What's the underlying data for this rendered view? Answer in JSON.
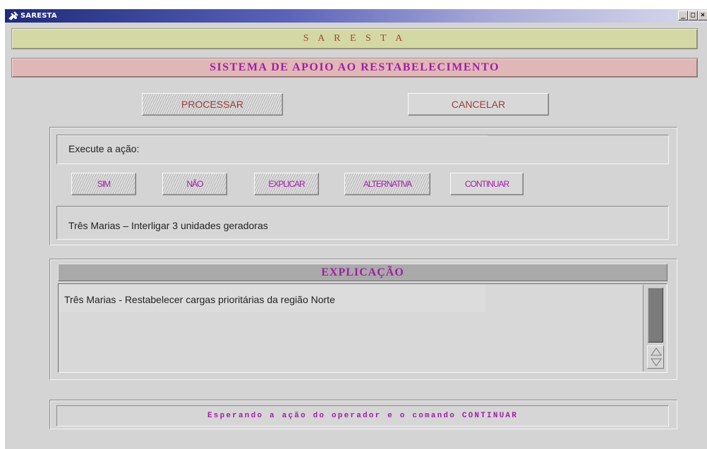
{
  "window": {
    "title": "SARESTA",
    "controls": {
      "minimize": "_",
      "maximize": "□",
      "close": "×"
    }
  },
  "header": {
    "app_name": "S A R E S T A",
    "subtitle": "SISTEMA DE APOIO AO RESTABELECIMENTO"
  },
  "toolbar": {
    "processar_label": "PROCESSAR",
    "cancelar_label": "CANCELAR"
  },
  "action_panel": {
    "prompt": "Execute a ação:",
    "buttons": {
      "sim": "SIM",
      "nao": "NÃO",
      "explicar": "EXPLICAR",
      "alternativa": "ALTERNATIVA",
      "continuar": "CONTINUAR"
    },
    "action_text": "Três Marias – Interligar 3 unidades geradoras"
  },
  "explanation": {
    "title": "EXPLICAÇÃO",
    "text": "Três Marias - Restabelecer cargas prioritárias da região Norte"
  },
  "status": {
    "message": "Esperando a ação do operador e o comando CONTINUAR"
  },
  "colors": {
    "accent": "#a01fa6",
    "banner_top": "#d4d8a4",
    "banner_sub": "#e0b7b7",
    "window_bg": "#d4d4d4"
  }
}
